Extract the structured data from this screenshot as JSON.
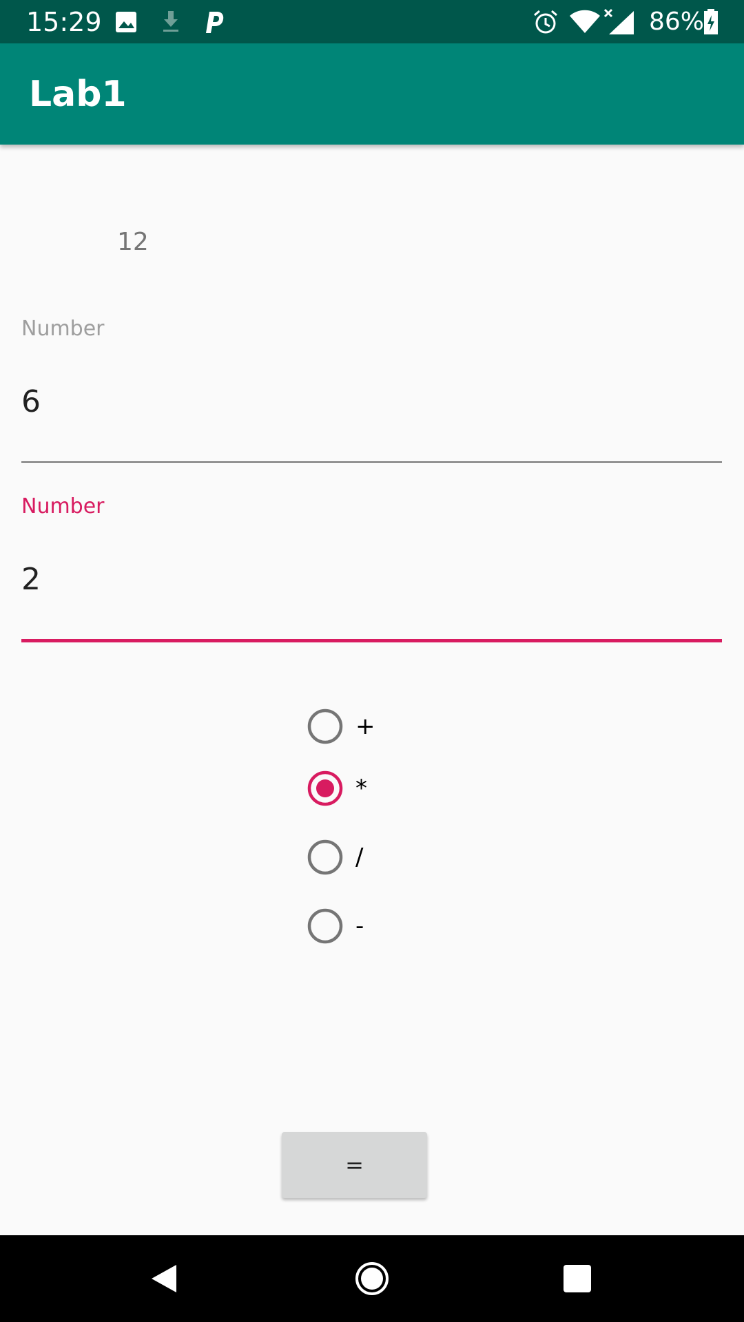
{
  "status_bar": {
    "time": "15:29",
    "battery_percent": "86%",
    "icons": [
      "image-icon",
      "download-icon",
      "parking-app-icon",
      "alarm-icon",
      "wifi-icon",
      "signal-icon",
      "battery-charging-icon"
    ]
  },
  "app_bar": {
    "title": "Lab1"
  },
  "result": {
    "value": "12"
  },
  "fields": [
    {
      "label": "Number",
      "value": "6",
      "focused": false
    },
    {
      "label": "Number",
      "value": "2",
      "focused": true
    }
  ],
  "operations": {
    "options": [
      {
        "label": "+",
        "checked": false
      },
      {
        "label": "*",
        "checked": true
      },
      {
        "label": "/",
        "checked": false
      },
      {
        "label": "-",
        "checked": false
      }
    ]
  },
  "equals_button": {
    "label": "="
  },
  "nav_bar": {
    "icons": [
      "back-icon",
      "home-icon",
      "recents-icon"
    ]
  },
  "colors": {
    "status_bar": "#00574b",
    "app_bar": "#008577",
    "accent": "#d81b60",
    "background": "#fafafa"
  }
}
